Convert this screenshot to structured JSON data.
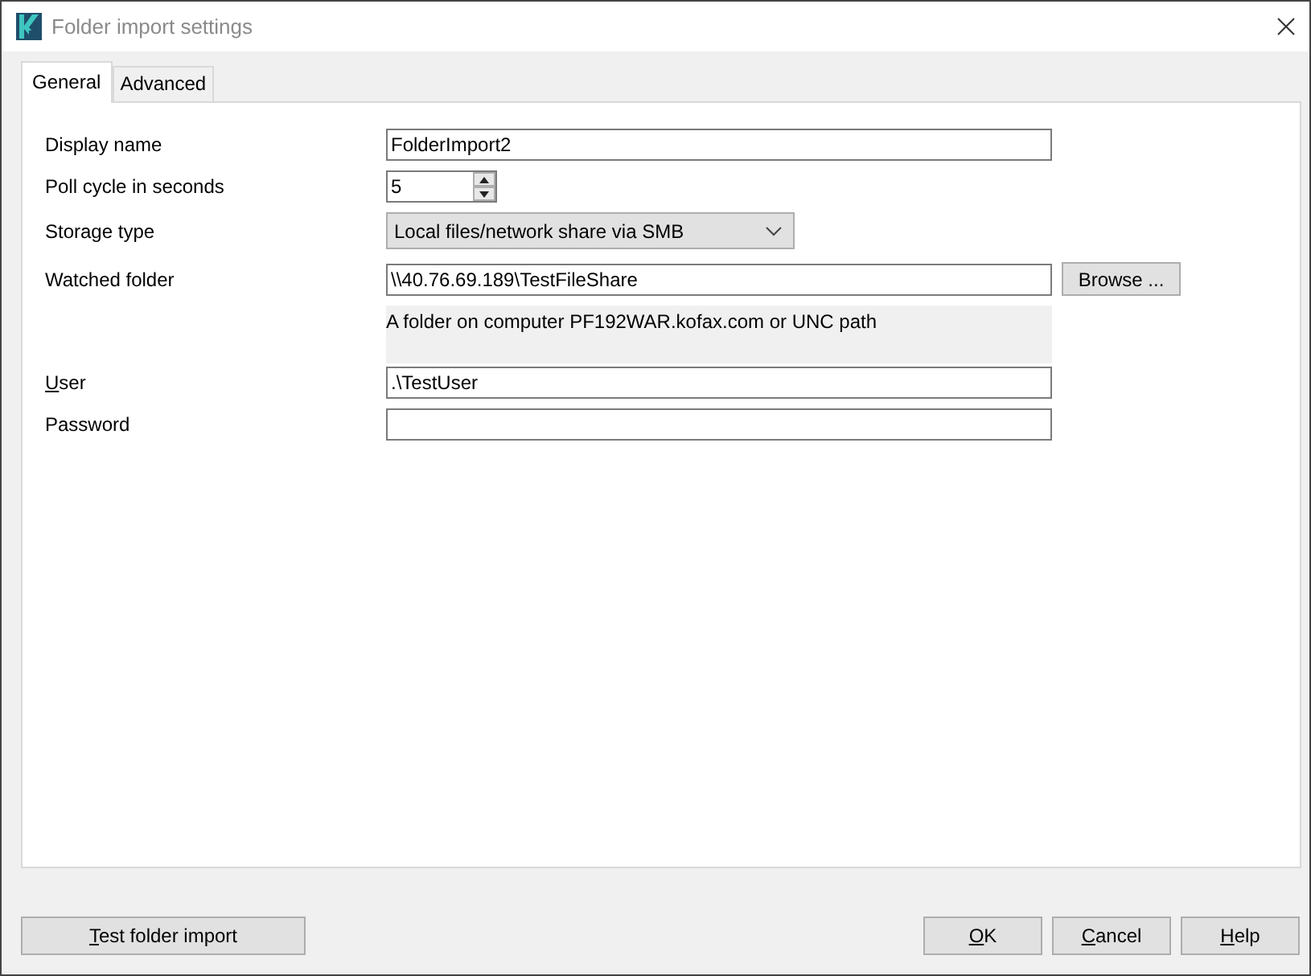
{
  "window": {
    "title": "Folder import settings"
  },
  "tabs": [
    {
      "label": "General",
      "selected": true
    },
    {
      "label": "Advanced",
      "selected": false
    }
  ],
  "fields": [
    {
      "kind": "text",
      "label": "Display name",
      "value": "FolderImport2",
      "mnemonic": false
    },
    {
      "kind": "spin",
      "label": "Poll cycle in seconds",
      "value": "5",
      "mnemonic": false
    },
    {
      "kind": "select",
      "label": "Storage type",
      "value": "Local files/network share via SMB",
      "mnemonic": false
    },
    {
      "kind": "browse",
      "label": "Watched folder",
      "value": "\\\\40.76.69.189\\TestFileShare",
      "button": "Browse ...",
      "mnemonic": false
    },
    {
      "kind": "hint",
      "text": "A folder on computer PF192WAR.kofax.com or UNC path"
    },
    {
      "kind": "text",
      "label": "User",
      "value": ".\\TestUser",
      "mnemonic": true
    },
    {
      "kind": "text",
      "label": "Password",
      "mnemonic": false
    }
  ],
  "buttons": [
    {
      "label": "Test folder import",
      "mnemonic": true,
      "kind": "action"
    },
    {
      "label": "OK",
      "mnemonic": true,
      "kind": "dialog"
    },
    {
      "label": "Cancel",
      "mnemonic": true,
      "kind": "dialog"
    },
    {
      "label": "Help",
      "mnemonic": true,
      "kind": "dialog"
    }
  ]
}
